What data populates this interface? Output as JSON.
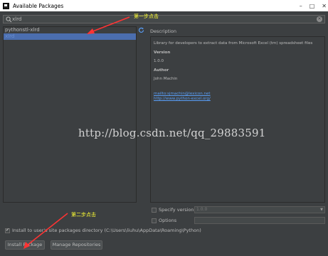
{
  "window": {
    "title": "Available Packages",
    "controls": [
      "–",
      "□",
      "✕"
    ]
  },
  "search": {
    "value": "xlrd",
    "prefix": "Q",
    "icon": "search-icon"
  },
  "packages": {
    "items": [
      {
        "label": "pythonstl-xlrd",
        "selected": false
      },
      {
        "label": "xlrd",
        "selected": true
      }
    ]
  },
  "description": {
    "label": "Description",
    "summary": "Library for developers to extract data from Microsoft Excel (tm) spreadsheet files",
    "version_heading": "Version",
    "version_value": "1.0.0",
    "author_heading": "Author",
    "author_value": "John Machin",
    "link_email": "mailto:sjmachin@lexicon.net",
    "link_site": "http://www.python-excel.org/"
  },
  "options": {
    "specify_version_label": "Specify version",
    "specify_version_value": "1.0.0",
    "options_label": "Options",
    "install_to_user_label": "Install to user's site packages directory (C:\\Users\\liuhu\\AppData\\Roaming\\Python)",
    "install_to_user_checked": true
  },
  "buttons": {
    "install": "Install Package",
    "manage": "Manage Repositories"
  },
  "annotations": {
    "step1": "第一步点击",
    "step2": "第二步点击",
    "watermark": "http://blog.csdn.net/qq_29883591",
    "color": "#ffff33",
    "arrow_color": "#ff3333"
  },
  "colors": {
    "background": "#3c3f41",
    "selection": "#4b6eaf",
    "link": "#589df6"
  }
}
